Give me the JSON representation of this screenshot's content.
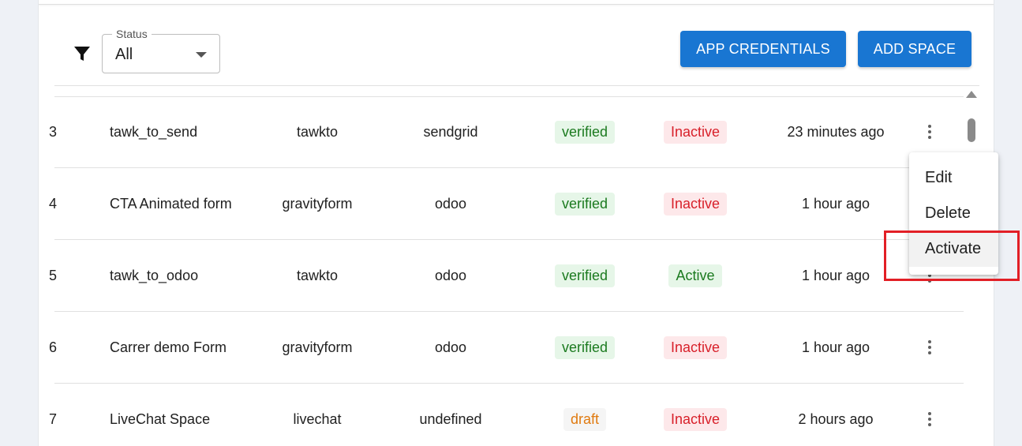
{
  "filter": {
    "icon": "filter-icon",
    "status_label": "Status",
    "status_value": "All"
  },
  "buttons": {
    "credentials": "APP CREDENTIALS",
    "add_space": "ADD SPACE"
  },
  "colors": {
    "primary": "#1976d2",
    "verified_bg": "#e6f6e8",
    "verified_text": "#1b7a1f",
    "inactive_bg": "#fde8ea",
    "inactive_text": "#d8202a",
    "draft_bg": "#f5f5f5",
    "draft_text": "#e07a10",
    "highlight": "#e21f26"
  },
  "rows": [
    {
      "id": "3",
      "name": "tawk_to_send",
      "source": "tawkto",
      "destination": "sendgrid",
      "verification": "verified",
      "status": "Inactive",
      "updated": "23 minutes ago"
    },
    {
      "id": "4",
      "name": "CTA Animated form",
      "source": "gravityform",
      "destination": "odoo",
      "verification": "verified",
      "status": "Inactive",
      "updated": "1 hour ago"
    },
    {
      "id": "5",
      "name": "tawk_to_odoo",
      "source": "tawkto",
      "destination": "odoo",
      "verification": "verified",
      "status": "Active",
      "updated": "1 hour ago"
    },
    {
      "id": "6",
      "name": "Carrer demo Form",
      "source": "gravityform",
      "destination": "odoo",
      "verification": "verified",
      "status": "Inactive",
      "updated": "1 hour ago"
    },
    {
      "id": "7",
      "name": "LiveChat Space",
      "source": "livechat",
      "destination": "undefined",
      "verification": "draft",
      "status": "Inactive",
      "updated": "2 hours ago"
    }
  ],
  "context_menu": {
    "items": [
      "Edit",
      "Delete",
      "Activate"
    ],
    "hovered": "Activate"
  }
}
